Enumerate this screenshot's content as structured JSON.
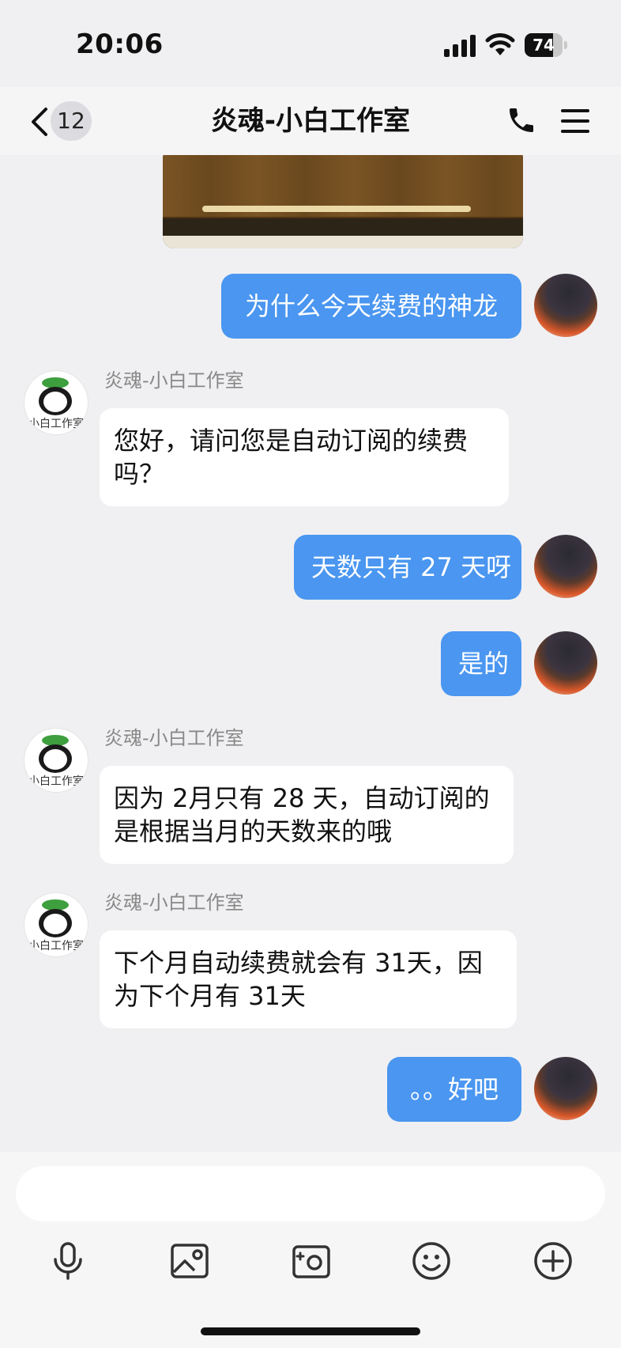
{
  "status_bar": {
    "time": "20:06",
    "battery_level": "74",
    "battery_fraction": 0.74
  },
  "nav": {
    "unread_count": "12",
    "title": "炎魂-小白工作室"
  },
  "messages": [
    {
      "sender": "me",
      "text": "为什么今天续费的神龙"
    },
    {
      "sender": "bot",
      "name": "炎魂-小白工作室",
      "text": "您好，请问您是自动订阅的续费吗？"
    },
    {
      "sender": "me",
      "text": "天数只有 27 天呀"
    },
    {
      "sender": "me",
      "text": "是的"
    },
    {
      "sender": "bot",
      "name": "炎魂-小白工作室",
      "text": "因为 2月只有 28 天，自动订阅的是根据当月的天数来的哦"
    },
    {
      "sender": "bot",
      "name": "炎魂-小白工作室",
      "text": "下个月自动续费就会有 31天，因为下个月有 31天"
    },
    {
      "sender": "me",
      "text": "。。好吧"
    }
  ],
  "bot_avatar_caption": "小白工作室",
  "input": {
    "value": "",
    "placeholder": ""
  },
  "toolbar": {
    "icons": [
      "microphone-icon",
      "image-icon",
      "camera-icon",
      "emoji-icon",
      "plus-icon"
    ]
  },
  "colors": {
    "outgoing_bubble": "#4a96f0",
    "incoming_bubble": "#ffffff",
    "background": "#f0f0f2"
  }
}
